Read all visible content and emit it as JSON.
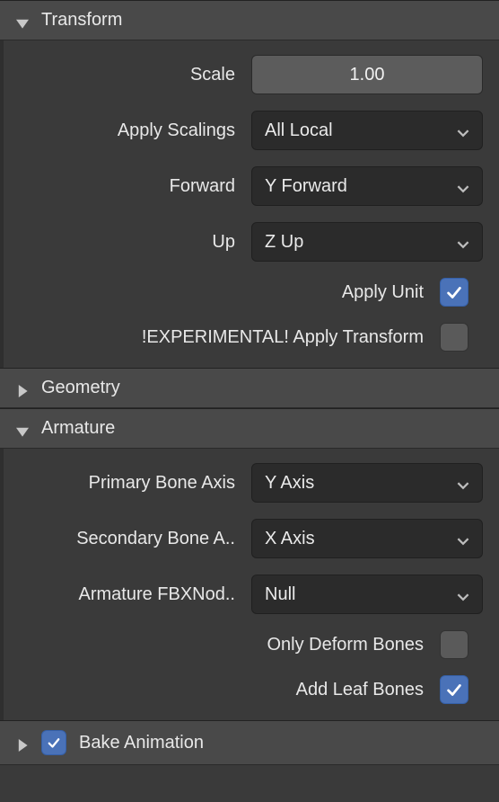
{
  "transform": {
    "title": "Transform",
    "expanded": true,
    "scale": {
      "label": "Scale",
      "value": "1.00"
    },
    "apply_scalings": {
      "label": "Apply Scalings",
      "value": "All Local"
    },
    "forward": {
      "label": "Forward",
      "value": "Y Forward"
    },
    "up": {
      "label": "Up",
      "value": "Z Up"
    },
    "apply_unit": {
      "label": "Apply Unit",
      "checked": true
    },
    "apply_transform": {
      "label": "!EXPERIMENTAL! Apply Transform",
      "checked": false
    }
  },
  "geometry": {
    "title": "Geometry",
    "expanded": false
  },
  "armature": {
    "title": "Armature",
    "expanded": true,
    "primary_bone_axis": {
      "label": "Primary Bone Axis",
      "value": "Y Axis"
    },
    "secondary_bone_axis": {
      "label": "Secondary Bone A..",
      "value": "X Axis"
    },
    "armature_fbxnode": {
      "label": "Armature FBXNod..",
      "value": "Null"
    },
    "only_deform_bones": {
      "label": "Only Deform Bones",
      "checked": false
    },
    "add_leaf_bones": {
      "label": "Add Leaf Bones",
      "checked": true
    }
  },
  "bake_animation": {
    "title": "Bake Animation",
    "expanded": false,
    "enabled": true
  }
}
